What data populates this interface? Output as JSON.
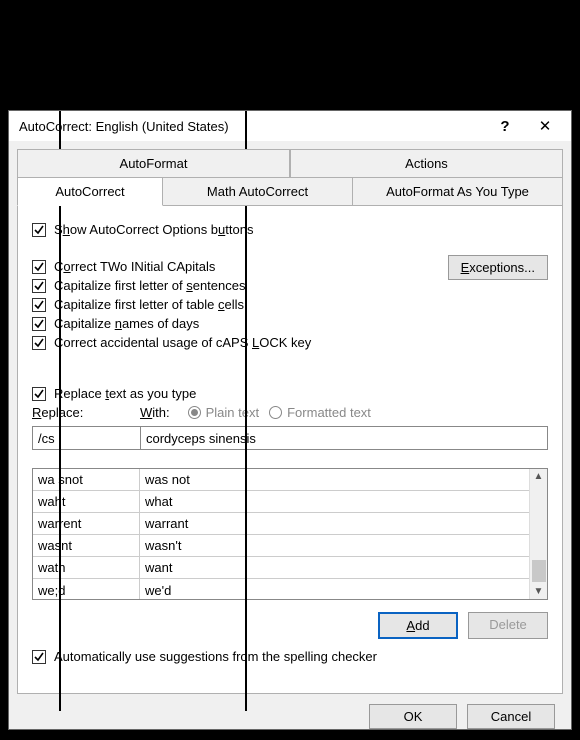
{
  "title": "AutoCorrect: English (United States)",
  "tabs_row1": [
    "AutoFormat",
    "Actions"
  ],
  "tabs_row2": [
    "AutoCorrect",
    "Math AutoCorrect",
    "AutoFormat As You Type"
  ],
  "checks": {
    "show_buttons": "Show AutoCorrect Options buttons",
    "two_initial": "Correct TWo INitial CApitals",
    "first_sentences": "Capitalize first letter of sentences",
    "first_cells": "Capitalize first letter of table cells",
    "names_days": "Capitalize names of days",
    "caps_lock": "Correct accidental usage of cAPS LOCK key",
    "replace_as_type": "Replace text as you type",
    "auto_suggest": "Automatically use suggestions from the spelling checker"
  },
  "labels": {
    "replace": "Replace:",
    "with": "With:",
    "plain": "Plain text",
    "formatted": "Formatted text"
  },
  "inputs": {
    "replace_value": "/cs",
    "with_value": "cordyceps sinensis"
  },
  "buttons": {
    "exceptions": "Exceptions...",
    "add": "Add",
    "delete": "Delete",
    "ok": "OK",
    "cancel": "Cancel"
  },
  "list": [
    {
      "from": "wa snot",
      "to": "was not"
    },
    {
      "from": "waht",
      "to": "what"
    },
    {
      "from": "warrent",
      "to": "warrant"
    },
    {
      "from": "wasnt",
      "to": "wasn't"
    },
    {
      "from": "watn",
      "to": "want"
    },
    {
      "from": "we;d",
      "to": "we'd"
    }
  ]
}
